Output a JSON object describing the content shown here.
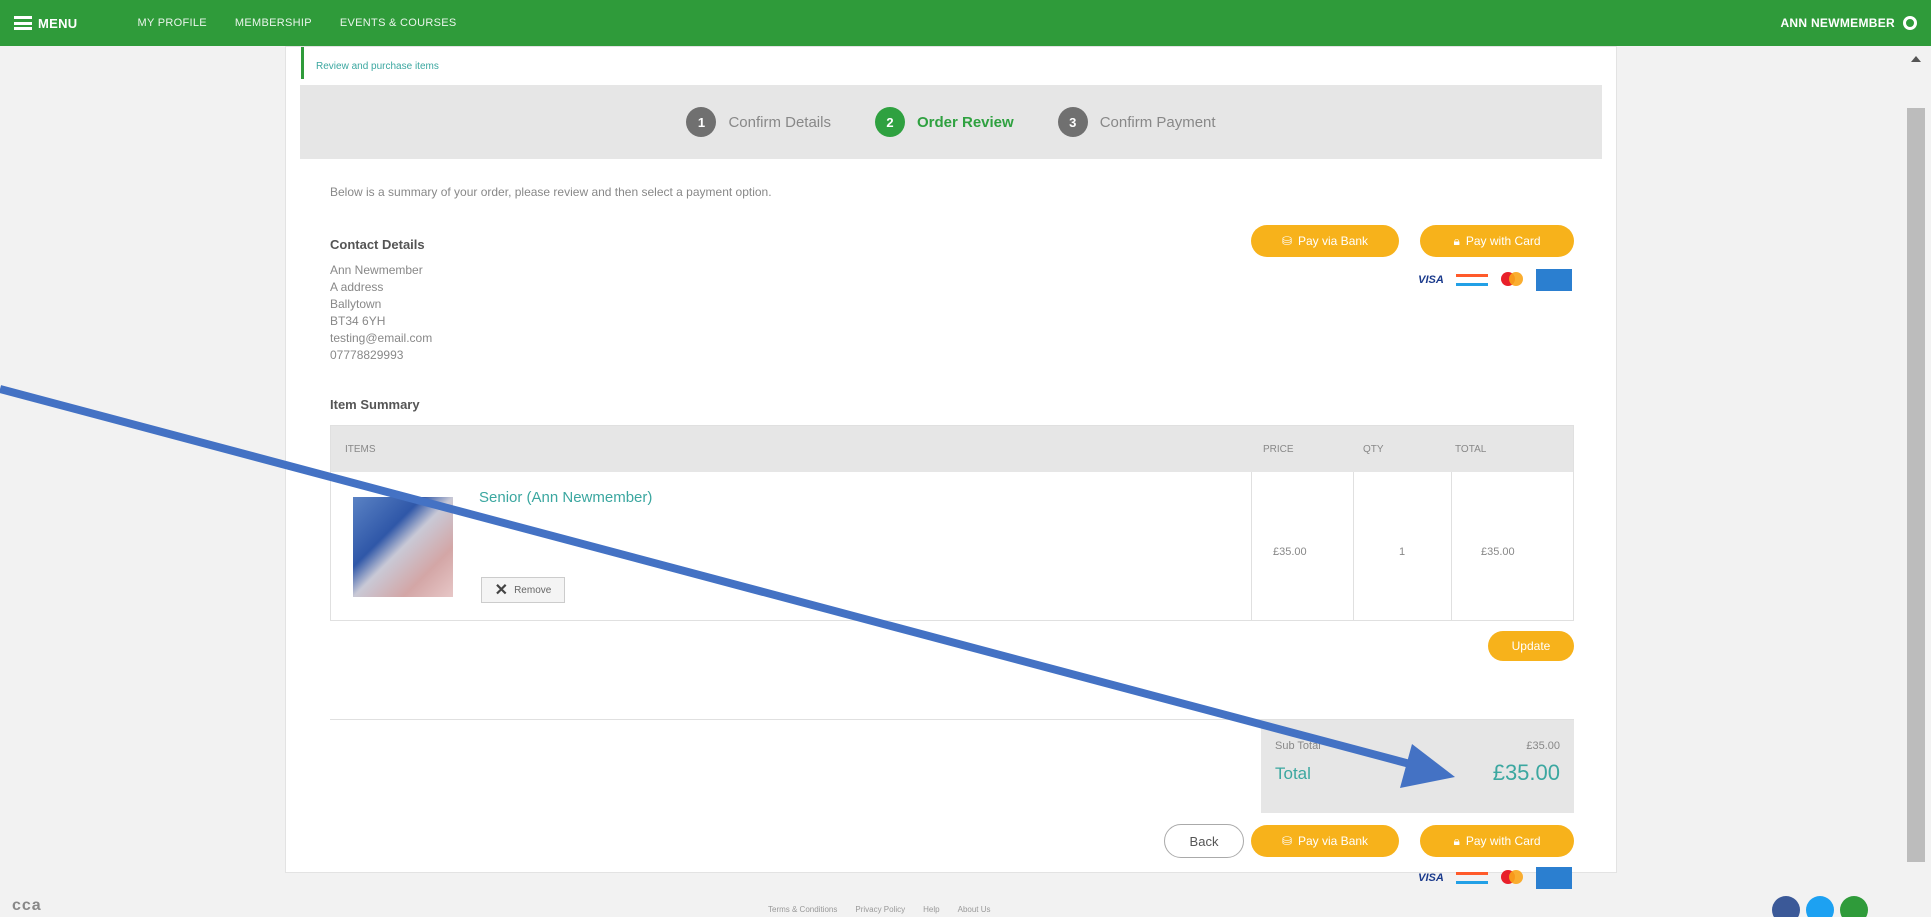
{
  "nav": {
    "menu_label": "MENU",
    "links": [
      "MY PROFILE",
      "MEMBERSHIP",
      "EVENTS & COURSES"
    ],
    "user_name": "ANN NEWMEMBER"
  },
  "breadcrumb": "Review and purchase items",
  "steps": [
    {
      "num": "1",
      "label": "Confirm Details"
    },
    {
      "num": "2",
      "label": "Order Review"
    },
    {
      "num": "3",
      "label": "Confirm Payment"
    }
  ],
  "intro": "Below is a summary of your order, please review and then select a payment option.",
  "contact": {
    "title": "Contact Details",
    "lines": [
      "Ann Newmember",
      "A address",
      "Ballytown",
      "BT34 6YH",
      "testing@email.com",
      "07778829993"
    ]
  },
  "payment": {
    "pay_bank": "Pay via Bank",
    "pay_card": "Pay with Card"
  },
  "summary": {
    "title": "Item Summary",
    "headers": {
      "items": "ITEMS",
      "price": "PRICE",
      "qty": "QTY",
      "total": "TOTAL"
    },
    "item": {
      "name": "Senior (Ann Newmember)",
      "price": "£35.00",
      "qty": "1",
      "total": "£35.00",
      "remove": "Remove"
    },
    "update": "Update"
  },
  "totals": {
    "sub_label": "Sub Total",
    "sub_value": "£35.00",
    "total_label": "Total",
    "total_value": "£35.00"
  },
  "back": "Back",
  "footer": {
    "logo": "cca",
    "links": [
      "Terms & Conditions",
      "Privacy Policy",
      "Help",
      "About Us"
    ]
  },
  "colors": {
    "brand_green": "#2f9b3a",
    "accent_yellow": "#f7b21b",
    "teal_text": "#3ba7a0",
    "annotation_blue": "#4472c4"
  }
}
